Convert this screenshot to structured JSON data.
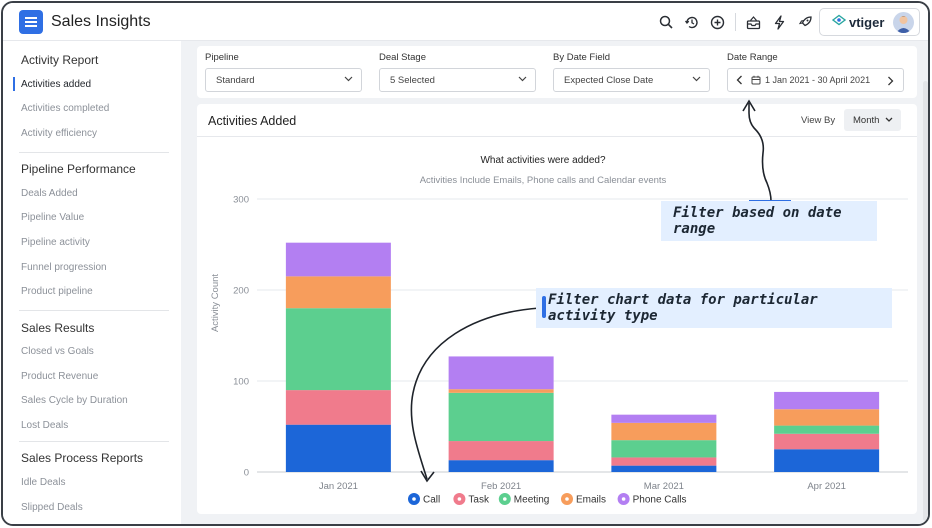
{
  "app": {
    "title": "Sales Insights",
    "brand": "vtiger",
    "accent_color": "#2f6fe4",
    "top_icons": [
      "search-icon",
      "history-icon",
      "add-circle-icon",
      "inbox-icon",
      "lightning-icon",
      "rocket-icon"
    ]
  },
  "sidebar": {
    "sections": [
      {
        "title": "Activity Report",
        "items": [
          "Activities added",
          "Activities completed",
          "Activity efficiency"
        ]
      },
      {
        "title": "Pipeline Performance",
        "items": [
          "Deals Added",
          "Pipeline Value",
          "Pipeline activity",
          "Funnel progression",
          "Product pipeline"
        ]
      },
      {
        "title": "Sales Results",
        "items": [
          "Closed vs Goals",
          "Product Revenue",
          "Sales Cycle by Duration",
          "Lost Deals"
        ]
      },
      {
        "title": "Sales Process Reports",
        "items": [
          "Idle Deals",
          "Slipped Deals"
        ]
      }
    ],
    "active_item": "Activities added"
  },
  "filters": {
    "pipeline": {
      "label": "Pipeline",
      "value": "Standard"
    },
    "deal_stage": {
      "label": "Deal Stage",
      "value": "5 Selected"
    },
    "date_field": {
      "label": "By Date Field",
      "value": "Expected Close Date"
    },
    "date_range": {
      "label": "Date Range",
      "value": "1 Jan 2021 - 30 April 2021"
    }
  },
  "chart_card": {
    "title": "Activities Added",
    "view_by_label": "View By",
    "view_by_value": "Month"
  },
  "chart_data": {
    "type": "bar",
    "stacked": true,
    "title": "What activities were added?",
    "subtitle": "Activities Include Emails, Phone calls and Calendar events",
    "ylabel": "Activity Count",
    "xlabel": "",
    "ylim": [
      0,
      300
    ],
    "yticks": [
      0,
      100,
      200,
      300
    ],
    "grid": true,
    "legend_position": "bottom",
    "categories": [
      "Jan 2021",
      "Feb 2021",
      "Mar 2021",
      "Apr 2021"
    ],
    "series": [
      {
        "name": "Call",
        "color": "#1c66d8",
        "values": [
          52,
          13,
          7,
          25
        ]
      },
      {
        "name": "Task",
        "color": "#f07b8c",
        "values": [
          38,
          21,
          9,
          17
        ]
      },
      {
        "name": "Meeting",
        "color": "#5ccf8f",
        "values": [
          90,
          53,
          19,
          9
        ]
      },
      {
        "name": "Emails",
        "color": "#f79d5c",
        "values": [
          35,
          4,
          19,
          18
        ]
      },
      {
        "name": "Phone Calls",
        "color": "#b37ff2",
        "values": [
          37,
          36,
          9,
          19
        ]
      }
    ]
  },
  "annotations": {
    "date_range_note": "Filter based on date range",
    "activity_type_note": "Filter chart data for particular activity type"
  }
}
